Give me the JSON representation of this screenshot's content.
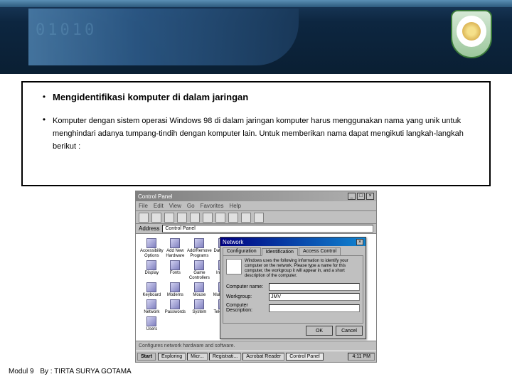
{
  "header": {
    "badge_name": "education-crest-icon"
  },
  "content": {
    "title": "Mengidentifikasi komputer di dalam jaringan",
    "body": "Komputer dengan sistem operasi Windows 98 di dalam jaringan komputer harus menggunakan nama yang unik untuk menghindari adanya tumpang-tindih dengan komputer lain. Untuk memberikan nama dapat mengikuti langkah-langkah berikut :"
  },
  "cp": {
    "window_title": "Control Panel",
    "menu": {
      "file": "File",
      "edit": "Edit",
      "view": "View",
      "go": "Go",
      "fav": "Favorites",
      "help": "Help"
    },
    "address_label": "Address",
    "address_value": "Control Panel",
    "items": [
      "Accessibility Options",
      "Add New Hardware",
      "Add/Remove Programs",
      "Date/Time",
      "Display",
      "Fonts",
      "Game Controllers",
      "Internet",
      "Keyboard",
      "Modems",
      "Mouse",
      "Multimedia",
      "Network",
      "Passwords",
      "System",
      "Telephony",
      "Users"
    ],
    "status": "Configures network hardware and software."
  },
  "dlg": {
    "title": "Network",
    "tabs": {
      "config": "Configuration",
      "ident": "Identification",
      "access": "Access Control"
    },
    "desc": "Windows uses the following information to identify your computer on the network. Please type a name for this computer, the workgroup it will appear in, and a short description of the computer.",
    "labels": {
      "name": "Computer name:",
      "wg": "Workgroup:",
      "desc": "Computer Description:"
    },
    "values": {
      "name": "",
      "wg": "JMV",
      "desc": ""
    },
    "buttons": {
      "ok": "OK",
      "cancel": "Cancel"
    }
  },
  "taskbar": {
    "start": "Start",
    "tasks": [
      "Exploring",
      "Micr...",
      "Registrati...",
      "Acrobat Reader"
    ],
    "active": "Control Panel",
    "time": "4:11 PM"
  },
  "footer": {
    "modul": "Modul 9",
    "by": "By : TIRTA SURYA GOTAMA"
  }
}
